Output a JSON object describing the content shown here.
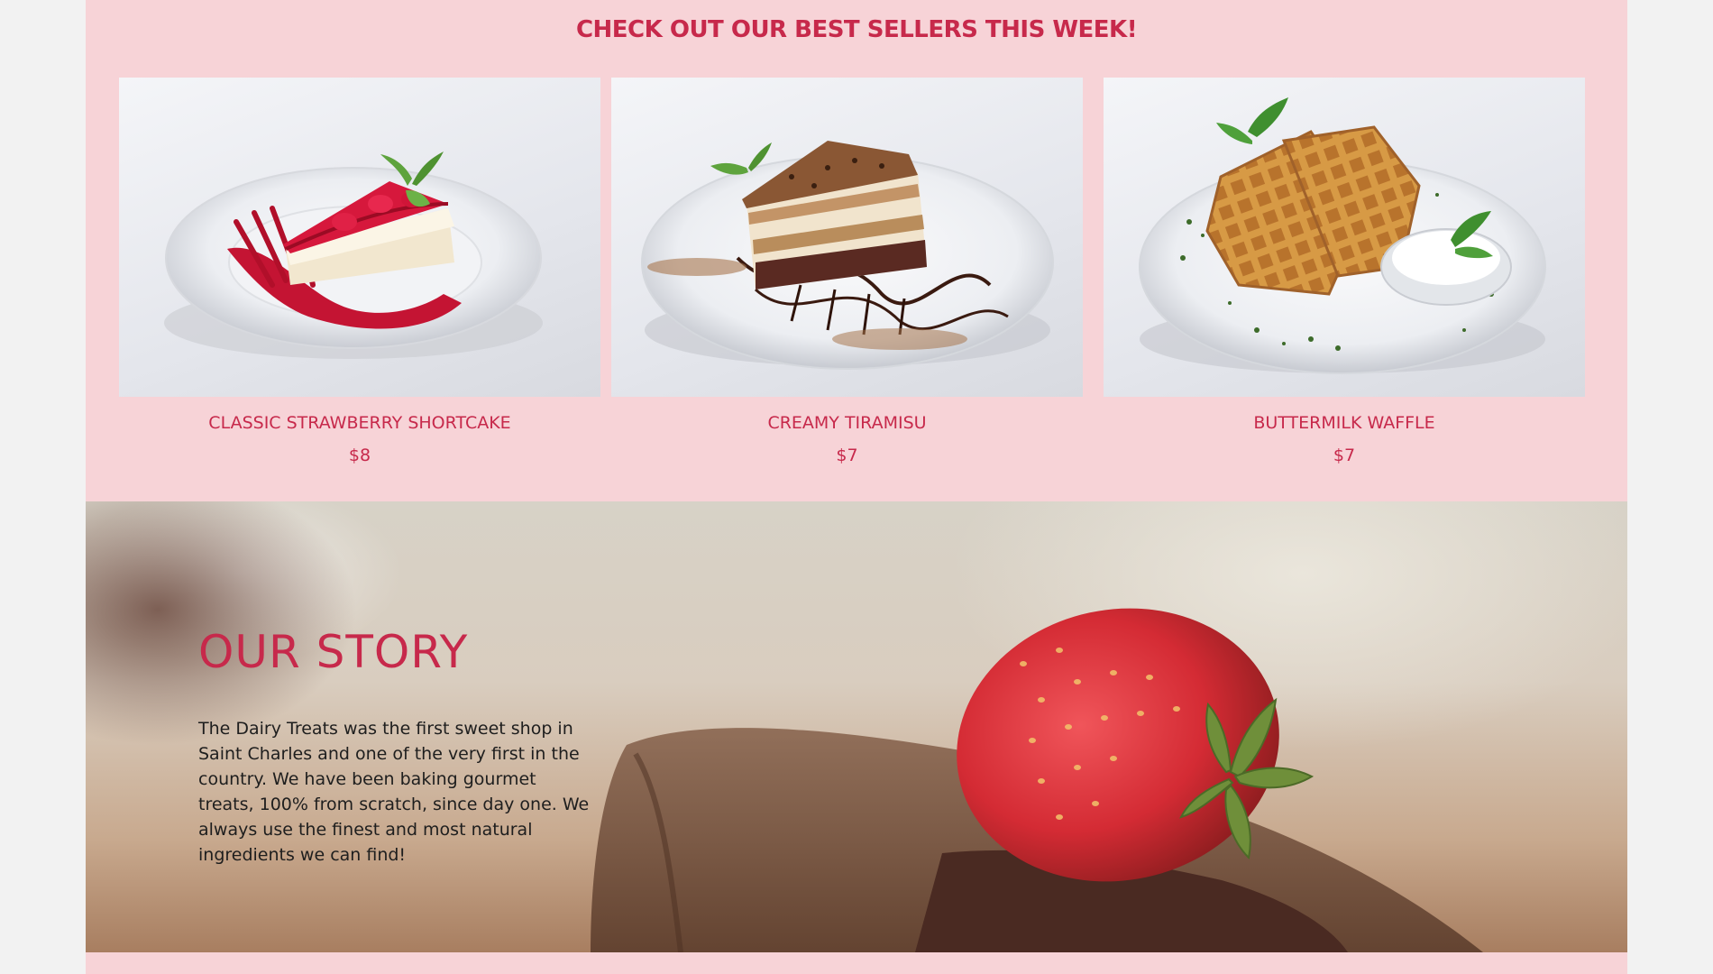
{
  "bestsellers": {
    "heading": "CHECK OUT OUR BEST SELLERS THIS WEEK!",
    "items": [
      {
        "name": "CLASSIC STRAWBERRY SHORTCAKE",
        "price": "$8",
        "icon": "strawberry-shortcake-photo"
      },
      {
        "name": "CREAMY TIRAMISU",
        "price": "$7",
        "icon": "tiramisu-photo"
      },
      {
        "name": "BUTTERMILK WAFFLE",
        "price": "$7",
        "icon": "waffle-photo"
      }
    ]
  },
  "story": {
    "heading": "OUR STORY",
    "body": "The Dairy Treats was the first sweet shop in Saint Charles and one of the very first in the country. We have been baking gourmet treats, 100% from scratch, since day one. We always use the finest and most natural ingredients we can find!",
    "background": "strawberry-chocolate-photo"
  },
  "colors": {
    "accent": "#c7294b",
    "pink_background": "#f7d3d7",
    "page_background": "#f2f2f2",
    "body_text": "#1e1e1e"
  }
}
